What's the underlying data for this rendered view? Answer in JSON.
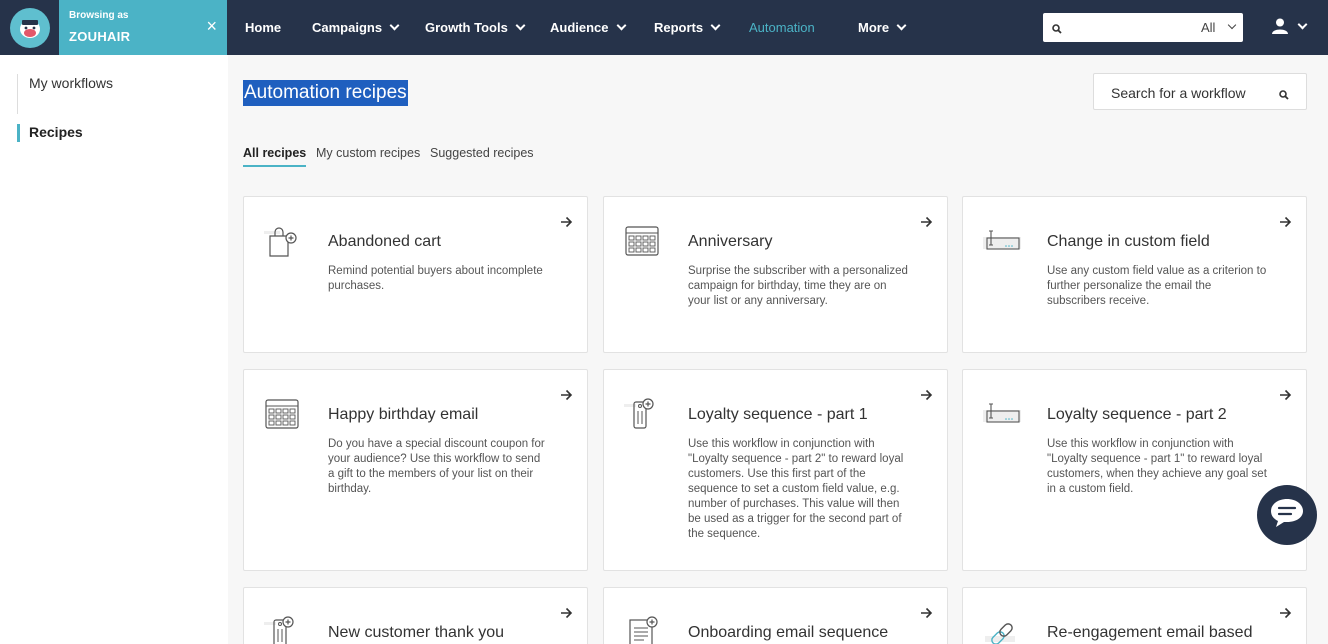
{
  "topbar": {
    "browsing_label": "Browsing as",
    "browsing_user": "ZOUHAIR",
    "close_glyph": "×",
    "nav": [
      {
        "label": "Home",
        "caret": false
      },
      {
        "label": "Campaigns",
        "caret": true
      },
      {
        "label": "Growth Tools",
        "caret": true
      },
      {
        "label": "Audience",
        "caret": true
      },
      {
        "label": "Reports",
        "caret": true
      },
      {
        "label": "Automation",
        "caret": false,
        "active": true
      },
      {
        "label": "More",
        "caret": true
      }
    ],
    "search": {
      "placeholder": "",
      "scope": "All"
    }
  },
  "sidebar": {
    "items": [
      {
        "label": "My workflows",
        "active": false
      },
      {
        "label": "Recipes",
        "active": true
      }
    ]
  },
  "main": {
    "title": "Automation recipes",
    "search_placeholder": "Search for a workflow",
    "tabs": [
      {
        "label": "All recipes",
        "active": true
      },
      {
        "label": "My custom recipes",
        "active": false
      },
      {
        "label": "Suggested recipes",
        "active": false
      }
    ],
    "cards": [
      {
        "title": "Abandoned cart",
        "desc": "Remind potential buyers about incomplete purchases.",
        "icon": "shopping-bag-icon"
      },
      {
        "title": "Anniversary",
        "desc": "Surprise the subscriber with a personalized campaign for birthday, time they are on your list or any anniversary.",
        "icon": "calendar-icon"
      },
      {
        "title": "Change in custom field",
        "desc": "Use any custom field value as a criterion to further personalize the email the subscribers receive.",
        "icon": "custom-field-icon"
      },
      {
        "title": "Happy birthday email",
        "desc": "Do you have a special discount coupon for your audience? Use this workflow to send a gift to the members of your list on their birthday.",
        "icon": "calendar-icon"
      },
      {
        "title": "Loyalty sequence - part 1",
        "desc": "Use this workflow in conjunction with \"Loyalty sequence - part 2\" to reward loyal customers. Use this first part of the sequence to set a custom field value, e.g. number of purchases. This value will then be used as a trigger for the second part of the sequence.",
        "icon": "tag-icon"
      },
      {
        "title": "Loyalty sequence - part 2",
        "desc": "Use this workflow in conjunction with \"Loyalty sequence - part 1\" to reward loyal customers, when they achieve any goal set in a custom field.",
        "icon": "custom-field-icon"
      },
      {
        "title": "New customer thank you",
        "desc": "",
        "icon": "tag-icon"
      },
      {
        "title": "Onboarding email sequence",
        "desc": "",
        "icon": "document-icon"
      },
      {
        "title": "Re-engagement email based",
        "desc": "",
        "icon": "link-icon"
      }
    ]
  },
  "colors": {
    "nav_bg": "#26334a",
    "accent": "#4bb3c6",
    "selection": "#1f5fbf"
  }
}
